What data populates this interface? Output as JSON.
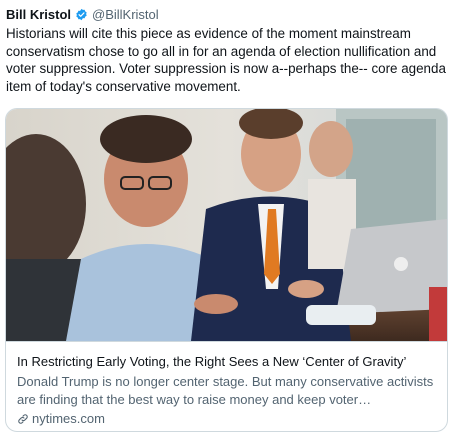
{
  "tweet": {
    "author_name": "Bill Kristol",
    "author_handle": "@BillKristol",
    "text": "Historians will cite this piece as evidence of the moment mainstream conservatism chose to go all in for an agenda of election nullification and voter suppression. Voter suppression is now a--perhaps the-- core agenda item of today's conservative movement."
  },
  "card": {
    "title": "In Restricting Early Voting, the Right Sees a New ‘Center of Gravity’",
    "description": "Donald Trump is no longer center stage. But many conservative activists are finding that the best way to raise money and keep voter…",
    "domain": "nytimes.com",
    "link_icon": "link-icon"
  },
  "icons": {
    "verified": "verified-badge-icon"
  },
  "colors": {
    "verified_blue": "#1d9bf0",
    "secondary_text": "#536471",
    "border": "#cfd9de"
  }
}
